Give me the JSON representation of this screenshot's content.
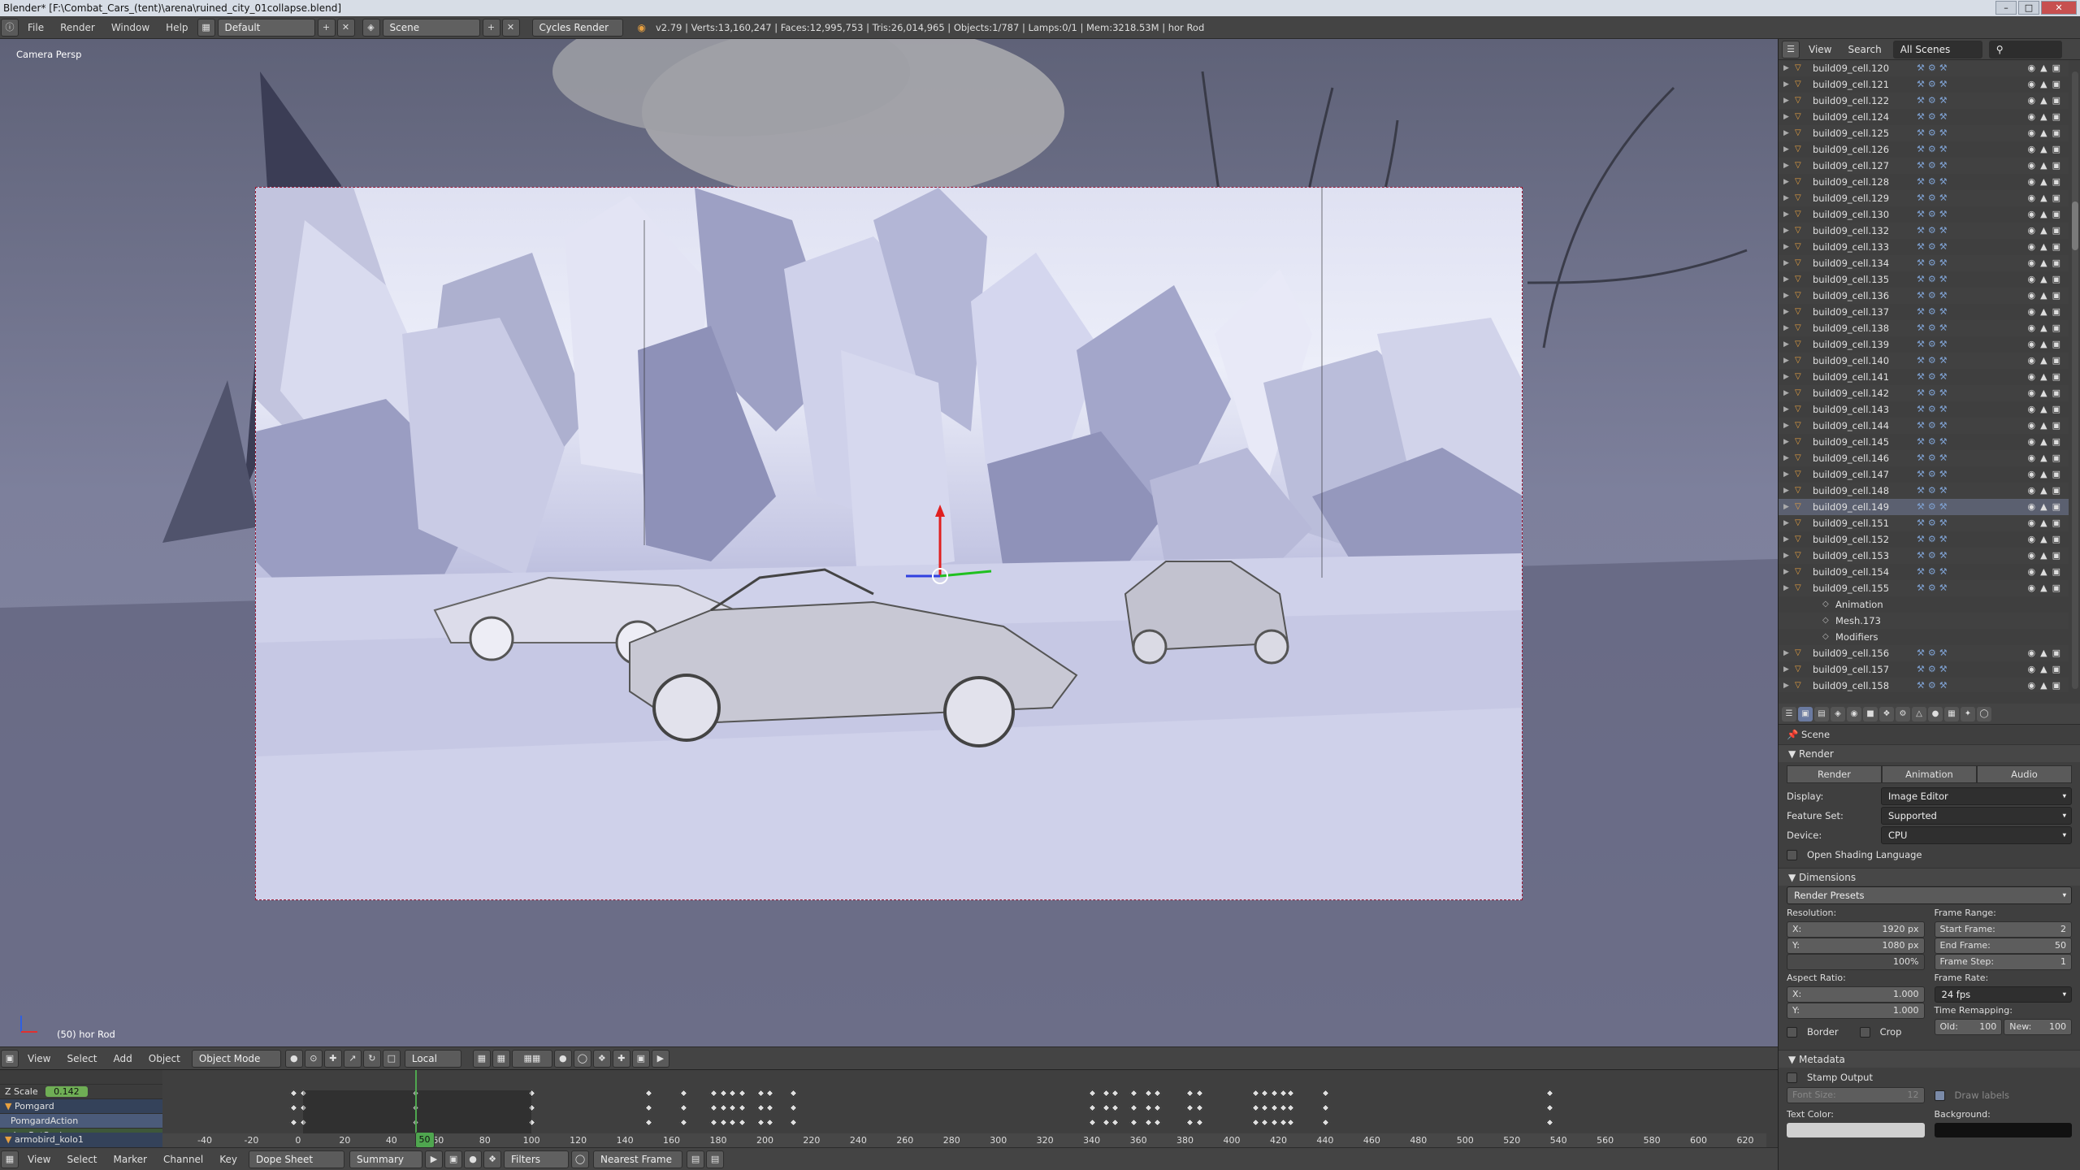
{
  "titlebar": {
    "title": "Blender* [F:\\Combat_Cars_(tent)\\arena\\ruined_city_01collapse.blend]",
    "min": "–",
    "max": "□",
    "close": "✕"
  },
  "infobar": {
    "menus": [
      "File",
      "Render",
      "Window",
      "Help"
    ],
    "layout": "Default",
    "scene": "Scene",
    "engine": "Cycles Render",
    "stats": "v2.79 | Verts:13,160,247 | Faces:12,995,753 | Tris:26,014,965 | Objects:1/787 | Lamps:0/1 | Mem:3218.53M | hor Rod"
  },
  "viewport": {
    "label": "Camera Persp",
    "object_info": "(50) hor Rod"
  },
  "vpheader": {
    "menus": [
      "View",
      "Select",
      "Add",
      "Object"
    ],
    "mode": "Object Mode",
    "orientation": "Local"
  },
  "dopesheet": {
    "channels": [
      {
        "name": "",
        "type": "plain"
      },
      {
        "name": "Z Scale",
        "value": "0.142",
        "type": "plain"
      },
      {
        "name": "Pomgard",
        "type": "obj"
      },
      {
        "name": "PomgardAction",
        "type": "blue"
      },
      {
        "name": "LocRotScale",
        "type": "green"
      },
      {
        "name": "armobird_kolo1",
        "type": "obj"
      }
    ],
    "ruler": [
      "-40",
      "-20",
      "0",
      "20",
      "40",
      "60",
      "80",
      "100",
      "120",
      "140",
      "160",
      "180",
      "200",
      "220",
      "240",
      "260",
      "280",
      "300",
      "320",
      "340",
      "360",
      "380",
      "400",
      "420",
      "440",
      "460",
      "480",
      "500",
      "520",
      "540",
      "560",
      "580",
      "600",
      "620"
    ],
    "current_frame": "50"
  },
  "dsheader": {
    "menus": [
      "View",
      "Select",
      "Marker",
      "Channel",
      "Key"
    ],
    "mode": "Dope Sheet",
    "summary": "Summary",
    "filters": "Filters",
    "snap": "Nearest Frame"
  },
  "outliner": {
    "menus": [
      "View",
      "Search"
    ],
    "scenes": "All Scenes",
    "items": [
      "build09_cell.120",
      "build09_cell.121",
      "build09_cell.122",
      "build09_cell.124",
      "build09_cell.125",
      "build09_cell.126",
      "build09_cell.127",
      "build09_cell.128",
      "build09_cell.129",
      "build09_cell.130",
      "build09_cell.132",
      "build09_cell.133",
      "build09_cell.134",
      "build09_cell.135",
      "build09_cell.136",
      "build09_cell.137",
      "build09_cell.138",
      "build09_cell.139",
      "build09_cell.140",
      "build09_cell.141",
      "build09_cell.142",
      "build09_cell.143",
      "build09_cell.144",
      "build09_cell.145",
      "build09_cell.146",
      "build09_cell.147",
      "build09_cell.148",
      "build09_cell.149",
      "build09_cell.151",
      "build09_cell.152",
      "build09_cell.153",
      "build09_cell.154",
      "build09_cell.155"
    ],
    "subitems": [
      "Animation",
      "Mesh.173",
      "Modifiers"
    ],
    "items_after": [
      "build09_cell.156",
      "build09_cell.157",
      "build09_cell.158"
    ]
  },
  "properties": {
    "breadcrumb": "Scene",
    "render_panel": "Render",
    "render_buttons": [
      "Render",
      "Animation",
      "Audio"
    ],
    "display_label": "Display:",
    "display_value": "Image Editor",
    "feature_label": "Feature Set:",
    "feature_value": "Supported",
    "device_label": "Device:",
    "device_value": "CPU",
    "osl": "Open Shading Language",
    "dimensions_panel": "Dimensions",
    "presets": "Render Presets",
    "resolution_label": "Resolution:",
    "res_x": "1920 px",
    "res_y": "1080 px",
    "res_pct": "100%",
    "frame_range_label": "Frame Range:",
    "start_frame": "2",
    "end_frame": "50",
    "frame_step": "1",
    "start_label": "Start Frame:",
    "end_label": "End Frame:",
    "step_label": "Frame Step:",
    "aspect_label": "Aspect Ratio:",
    "aspect_x": "1.000",
    "aspect_y": "1.000",
    "frame_rate_label": "Frame Rate:",
    "frame_rate": "24 fps",
    "time_remap_label": "Time Remapping:",
    "old": "100",
    "new": "100",
    "border": "Border",
    "crop": "Crop",
    "metadata_panel": "Metadata",
    "stamp_output": "Stamp Output",
    "font_size_label": "Font Size:",
    "font_size": "12",
    "draw_labels": "Draw labels",
    "text_color": "Text Color:",
    "background": "Background:"
  }
}
